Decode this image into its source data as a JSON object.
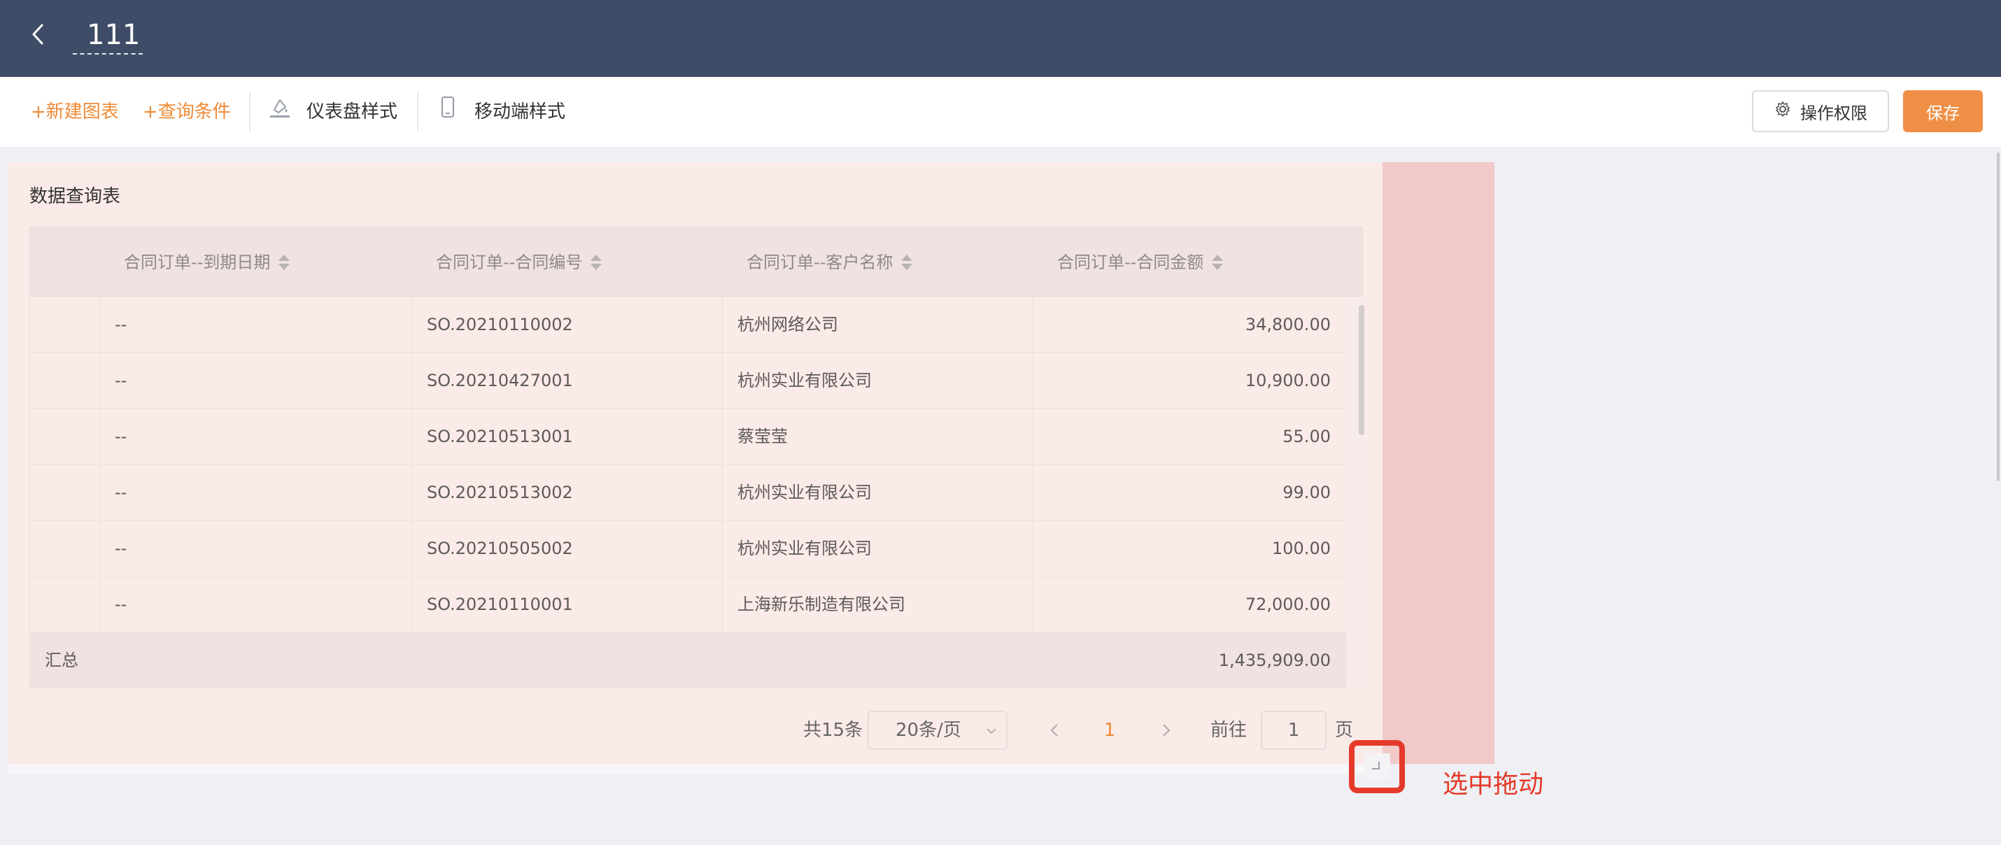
{
  "header": {
    "title": "111"
  },
  "toolbar": {
    "new_chart": "+新建图表",
    "query_conditions": "+查询条件",
    "dashboard_style": "仪表盘样式",
    "mobile_style": "移动端样式",
    "permissions": "操作权限",
    "save": "保存"
  },
  "panel": {
    "title": "数据查询表",
    "columns": [
      "合同订单--到期日期",
      "合同订单--合同编号",
      "合同订单--客户名称",
      "合同订单--合同金额"
    ],
    "rows": [
      {
        "due_date": "--",
        "contract_no": "SO.20210110002",
        "customer": "杭州网络公司",
        "amount": "34,800.00"
      },
      {
        "due_date": "--",
        "contract_no": "SO.20210427001",
        "customer": "杭州实业有限公司",
        "amount": "10,900.00"
      },
      {
        "due_date": "--",
        "contract_no": "SO.20210513001",
        "customer": "蔡莹莹",
        "amount": "55.00"
      },
      {
        "due_date": "--",
        "contract_no": "SO.20210513002",
        "customer": "杭州实业有限公司",
        "amount": "99.00"
      },
      {
        "due_date": "--",
        "contract_no": "SO.20210505002",
        "customer": "杭州实业有限公司",
        "amount": "100.00"
      },
      {
        "due_date": "--",
        "contract_no": "SO.20210110001",
        "customer": "上海新乐制造有限公司",
        "amount": "72,000.00"
      }
    ],
    "summary": {
      "label": "汇总",
      "amount": "1,435,909.00"
    }
  },
  "pagination": {
    "total": "共15条",
    "page_size": "20条/页",
    "current_page": "1",
    "goto_label": "前往",
    "goto_value": "1",
    "page_unit": "页"
  },
  "annotation": {
    "text": "选中拖动",
    "color": "#e53a2a"
  },
  "colors": {
    "header_bg": "#3e4c67",
    "accent": "#ef8a37",
    "save_bg": "#ef8f46",
    "panel_bg": "#faeae8",
    "panel_side_bg": "#f1c9c9"
  }
}
